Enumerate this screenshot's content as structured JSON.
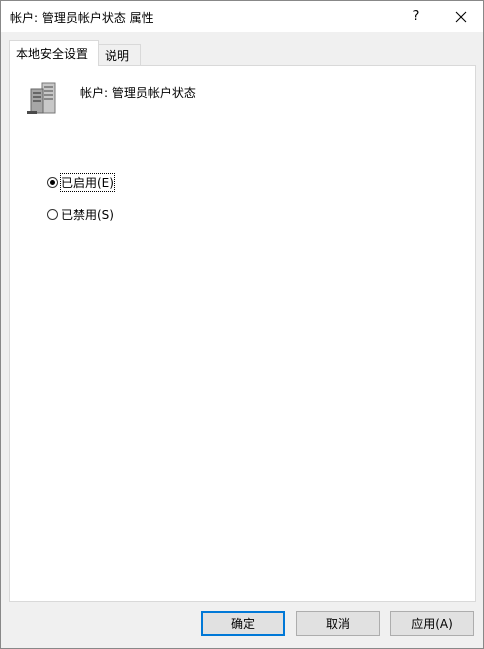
{
  "window": {
    "title": "帐户: 管理员帐户状态 属性",
    "help_label": "?"
  },
  "tabs": [
    {
      "label": "本地安全设置",
      "active": true
    },
    {
      "label": "说明",
      "active": false
    }
  ],
  "policy": {
    "name": "帐户: 管理员帐户状态",
    "icon": "server-icon"
  },
  "options": {
    "enabled_label": "已启用(E)",
    "disabled_label": "已禁用(S)",
    "selected": "enabled"
  },
  "buttons": {
    "ok_label": "确定",
    "cancel_label": "取消",
    "apply_label": "应用(A)"
  },
  "colors": {
    "accent": "#0078d7"
  }
}
